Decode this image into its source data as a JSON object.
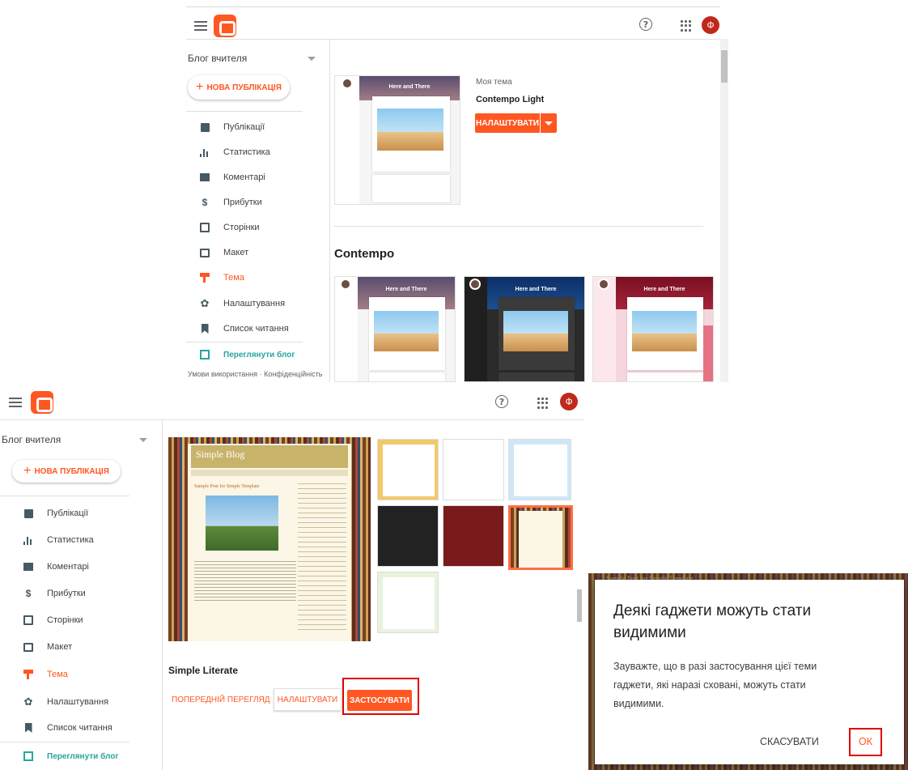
{
  "colors": {
    "brand": "#ff5722",
    "accent_teal": "#26a69a",
    "avatar_bg": "#c1281c",
    "highlight_box": "#e00000"
  },
  "top_panel": {
    "header": {
      "avatar_letter": "Ф",
      "help_icon": "?"
    },
    "sidebar": {
      "blog_name": "Блог вчителя",
      "new_post": "НОВА ПУБЛІКАЦІЯ",
      "items": [
        {
          "label": "Публікації",
          "icon": "posts-icon"
        },
        {
          "label": "Статистика",
          "icon": "stats-icon"
        },
        {
          "label": "Коментарі",
          "icon": "comment-icon"
        },
        {
          "label": "Прибутки",
          "icon": "dollar-icon"
        },
        {
          "label": "Сторінки",
          "icon": "pages-icon"
        },
        {
          "label": "Макет",
          "icon": "layout-icon"
        },
        {
          "label": "Тема",
          "icon": "theme-icon"
        },
        {
          "label": "Налаштування",
          "icon": "gear-icon"
        },
        {
          "label": "Список читання",
          "icon": "bookmark-icon"
        }
      ],
      "view_blog": "Переглянути блог",
      "footer_terms": "Умови використання",
      "footer_sep": "·",
      "footer_privacy": "Конфіденційність"
    },
    "my_theme": {
      "label": "Моя тема",
      "name": "Contempo Light",
      "customize": "НАЛАШТУВАТИ",
      "thumb_title": "Here and There"
    },
    "section_title": "Contempo",
    "thumb_titles": [
      "Here and There",
      "Here and There",
      "Here and There"
    ]
  },
  "bottom_panel": {
    "header": {
      "avatar_letter": "Ф",
      "help_icon": "?"
    },
    "sidebar": {
      "blog_name": "Блог вчителя",
      "new_post": "НОВА ПУБЛІКАЦІЯ",
      "items": [
        {
          "label": "Публікації",
          "icon": "posts-icon"
        },
        {
          "label": "Статистика",
          "icon": "stats-icon"
        },
        {
          "label": "Коментарі",
          "icon": "comment-icon"
        },
        {
          "label": "Прибутки",
          "icon": "dollar-icon"
        },
        {
          "label": "Сторінки",
          "icon": "pages-icon"
        },
        {
          "label": "Макет",
          "icon": "layout-icon"
        },
        {
          "label": "Тема",
          "icon": "theme-icon"
        },
        {
          "label": "Налаштування",
          "icon": "gear-icon"
        },
        {
          "label": "Список читання",
          "icon": "bookmark-icon"
        }
      ],
      "view_blog": "Переглянути блог"
    },
    "preview_blog_title": "Simple Blog",
    "preview_post_title": "Sample Post for Simple Template",
    "theme_name": "Simple Literate",
    "preview_button": "ПОПЕРЕДНІЙ ПЕРЕГЛЯД",
    "customize_button": "НАЛАШТУВАТИ",
    "apply_button": "ЗАСТОСУВАТИ"
  },
  "dialog": {
    "backdrop_text": "Sample Post for Simple Template",
    "title": "Деякі гаджети можуть стати видимими",
    "body": "Зауважте, що в разі застосування цієї теми гаджети, які наразі сховані, можуть стати видимими.",
    "cancel": "СКАСУВАТИ",
    "ok": "ОК"
  }
}
